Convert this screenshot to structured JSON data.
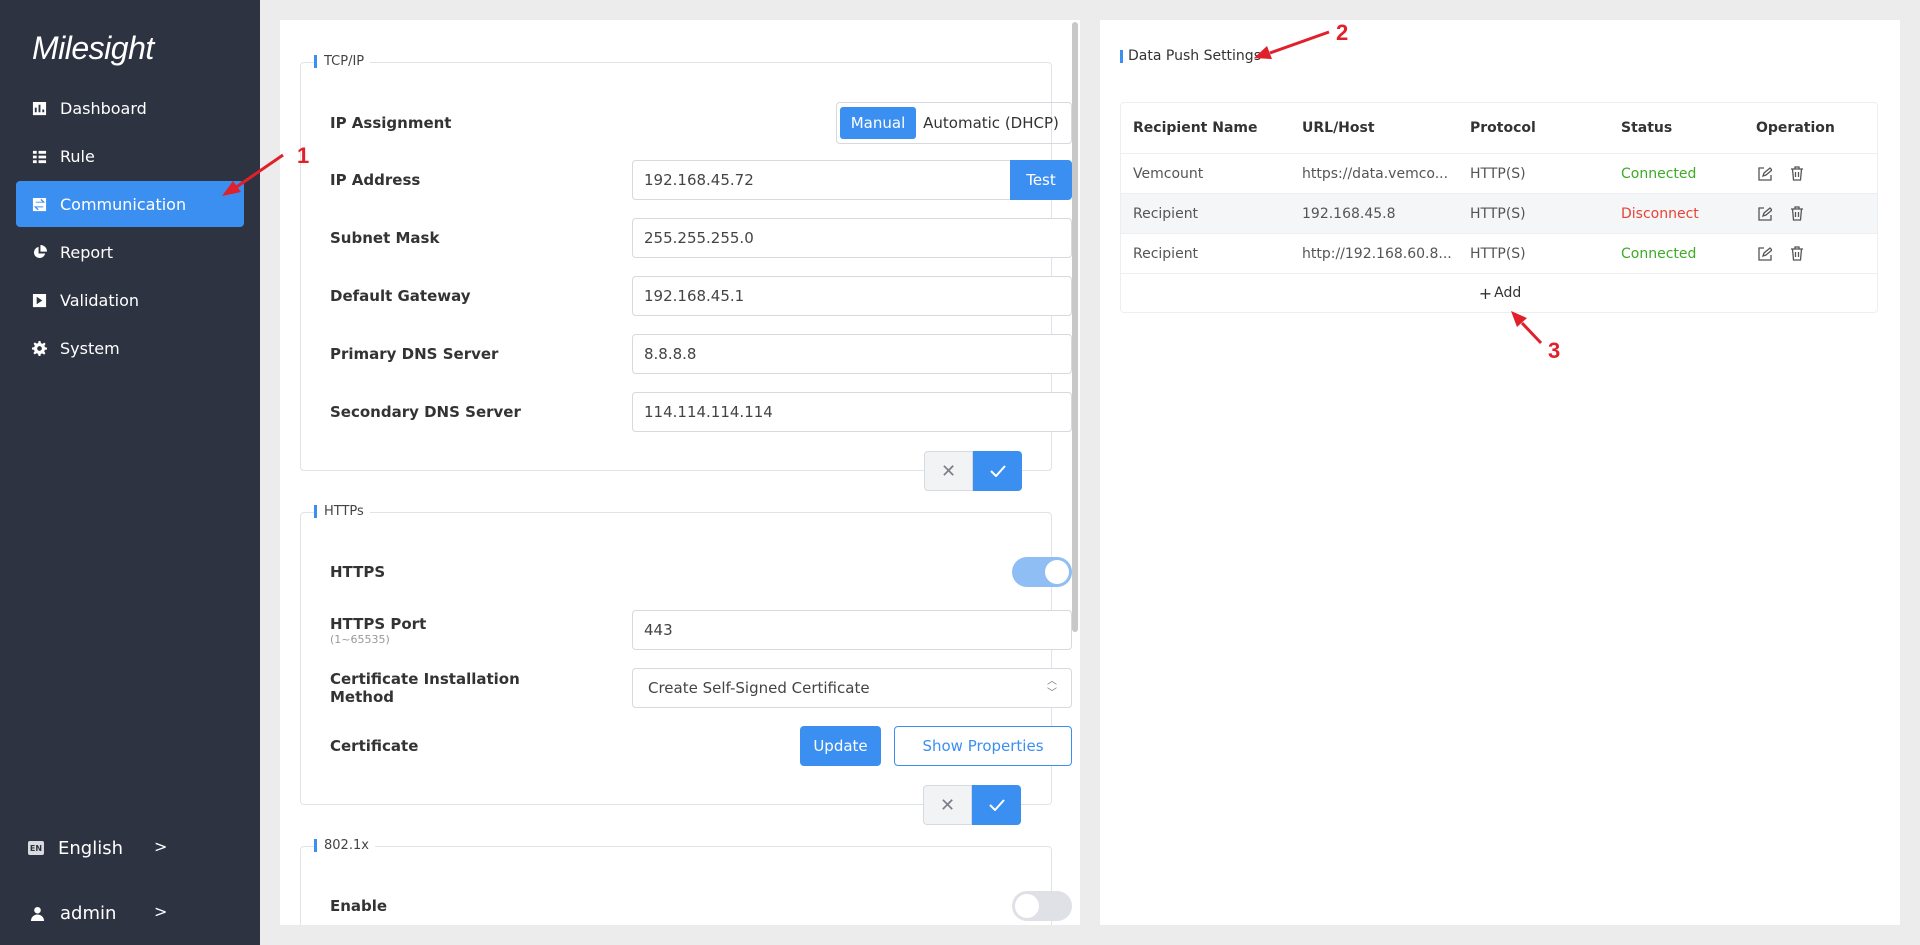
{
  "brand": {
    "logo": "Milesight"
  },
  "sidebar": {
    "items": [
      {
        "label": "Dashboard",
        "icon": "bar-chart-icon"
      },
      {
        "label": "Rule",
        "icon": "list-icon"
      },
      {
        "label": "Communication",
        "icon": "swap-icon",
        "active": true
      },
      {
        "label": "Report",
        "icon": "pie-chart-icon"
      },
      {
        "label": "Validation",
        "icon": "shield-check-icon"
      },
      {
        "label": "System",
        "icon": "gear-icon"
      }
    ],
    "language": {
      "badge": "EN",
      "label": "English",
      "chevron": ">"
    },
    "user": {
      "label": "admin",
      "chevron": ">"
    }
  },
  "tcpip": {
    "legend": "TCP/IP",
    "ip_assignment": {
      "label": "IP Assignment",
      "options": [
        "Manual",
        "Automatic (DHCP)"
      ],
      "selected": "Manual"
    },
    "ip_address": {
      "label": "IP Address",
      "value": "192.168.45.72",
      "test_label": "Test"
    },
    "subnet_mask": {
      "label": "Subnet Mask",
      "value": "255.255.255.0"
    },
    "default_gateway": {
      "label": "Default Gateway",
      "value": "192.168.45.1"
    },
    "primary_dns": {
      "label": "Primary DNS Server",
      "value": "8.8.8.8"
    },
    "secondary_dns": {
      "label": "Secondary DNS Server",
      "value": "114.114.114.114"
    }
  },
  "https": {
    "legend": "HTTPs",
    "https_toggle": {
      "label": "HTTPS",
      "enabled": true
    },
    "port": {
      "label": "HTTPS Port",
      "hint": "(1~65535)",
      "value": "443"
    },
    "cert_method": {
      "label": "Certificate Installation Method",
      "value": "Create Self-Signed Certificate"
    },
    "certificate": {
      "label": "Certificate",
      "update_label": "Update",
      "show_label": "Show Properties"
    }
  },
  "dot1x": {
    "legend": "802.1x",
    "enable": {
      "label": "Enable",
      "enabled": false
    }
  },
  "data_push": {
    "title": "Data Push Settings",
    "columns": [
      "Recipient Name",
      "URL/Host",
      "Protocol",
      "Status",
      "Operation"
    ],
    "rows": [
      {
        "name": "Vemcount",
        "url": "https://data.vemco...",
        "protocol": "HTTP(S)",
        "status": "Connected"
      },
      {
        "name": "Recipient",
        "url": "192.168.45.8",
        "protocol": "HTTP(S)",
        "status": "Disconnect"
      },
      {
        "name": "Recipient",
        "url": "http://192.168.60.8...",
        "protocol": "HTTP(S)",
        "status": "Connected"
      }
    ],
    "add_label": "Add"
  },
  "annotations": [
    "1",
    "2",
    "3"
  ],
  "colors": {
    "accent": "#3b8ff0",
    "sidebar": "#2d3340",
    "connected": "#3daa25",
    "disconnect": "#e84234",
    "annotation": "#e0202a"
  }
}
